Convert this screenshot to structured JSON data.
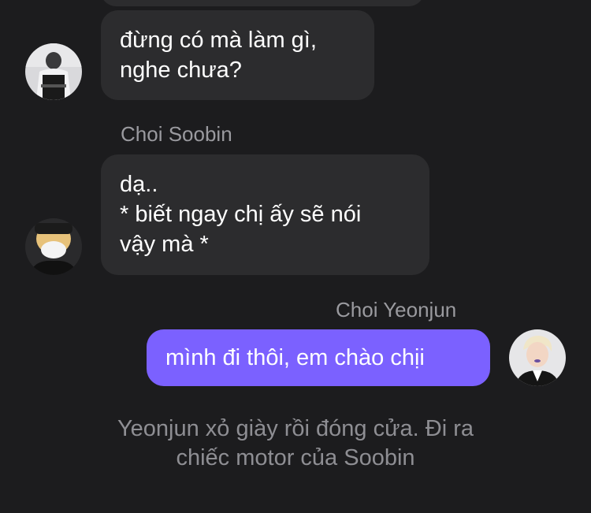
{
  "messages": [
    {
      "sender": "",
      "lines": [
        "đừng có mà làm gì,",
        "nghe chưa?"
      ]
    },
    {
      "sender": "Choi Soobin",
      "lines": [
        "dạ..",
        "* biết ngay chị ấy sẽ nói",
        "vậy mà *"
      ]
    },
    {
      "sender": "Choi Yeonjun",
      "lines": [
        "mình đi thôi, em chào chịi"
      ]
    }
  ],
  "narration": {
    "lines": [
      "Yeonjun xỏ giày rồi đóng cửa. Đi ra",
      "chiếc motor của Soobin"
    ]
  },
  "colors": {
    "background": "#1c1c1e",
    "incoming_bubble": "#2c2c2e",
    "outgoing_bubble": "#7b61ff",
    "sender_name": "#9a9a9f",
    "narration": "#8e8e93"
  }
}
